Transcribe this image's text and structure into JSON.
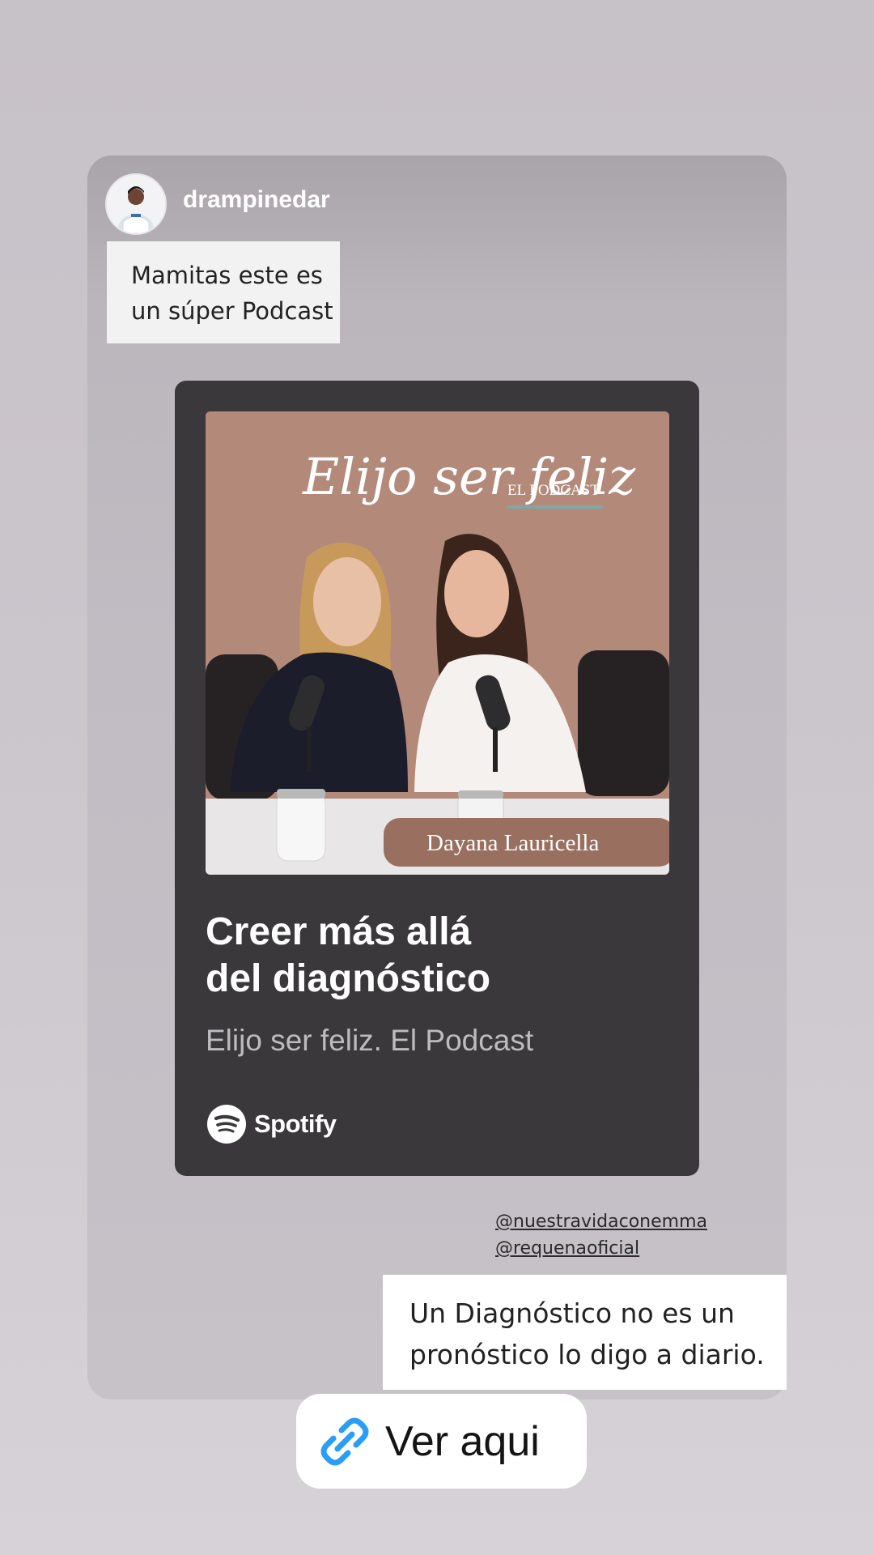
{
  "story": {
    "username": "drampinedar",
    "top_sticker": {
      "line1": "Mamitas este es",
      "line2": "un súper Podcast"
    },
    "podcast": {
      "cover_script_title": "Elijo ser feliz",
      "cover_badge": "EL PODCAST",
      "cover_host": "Dayana Lauricella",
      "episode_title_line1": "Creer más allá",
      "episode_title_line2": "del diagnóstico",
      "show_name": "Elijo ser feliz. El Podcast",
      "platform": "Spotify",
      "platform_icon": "spotify-logo-icon"
    },
    "mentions": [
      "@nuestravidaconemma",
      "@requenaoficial"
    ],
    "bottom_sticker": {
      "line1": "Un Diagnóstico no es un",
      "line2": "pronóstico lo digo a diario."
    },
    "link": {
      "label": "Ver aqui",
      "icon": "link-icon"
    }
  },
  "colors": {
    "card_bg": "#3a383b",
    "cover_bg": "#b3897a",
    "link_icon": "#2a9df4"
  }
}
